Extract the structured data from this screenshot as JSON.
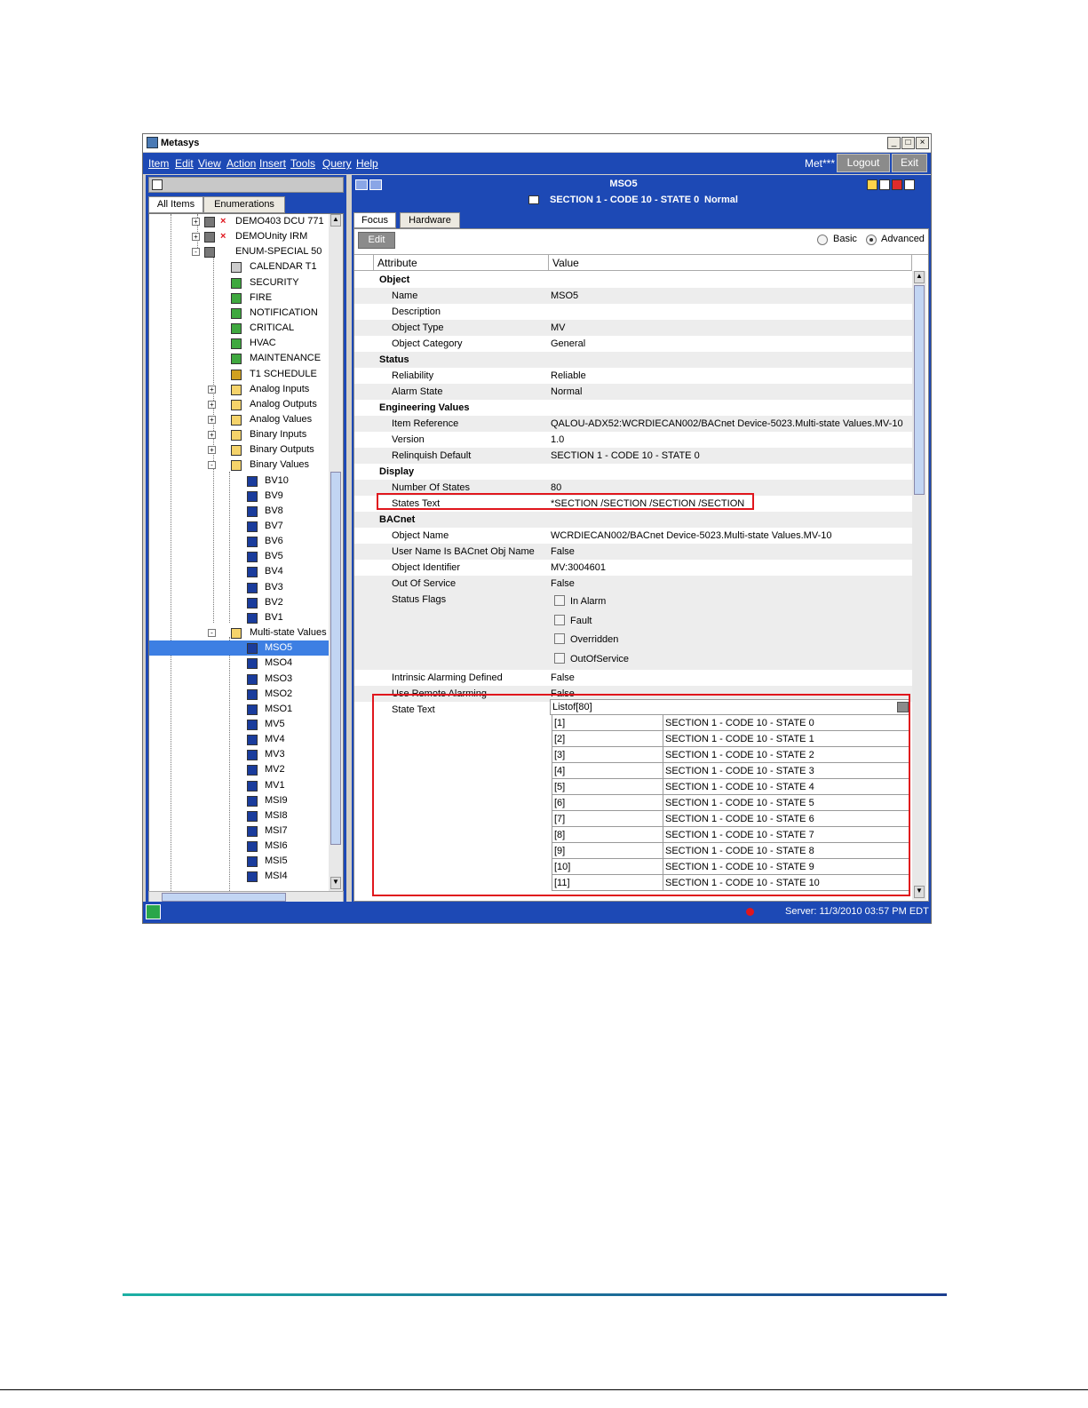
{
  "window": {
    "title": "Metasys"
  },
  "menu": [
    "Item",
    "Edit",
    "View",
    "Action",
    "Insert",
    "Tools",
    "Query",
    "Help"
  ],
  "header": {
    "user": "Met***",
    "logout": "Logout",
    "exit": "Exit"
  },
  "nav": {
    "tabs": [
      "All Items",
      "Enumerations"
    ],
    "tree": [
      {
        "label": "DEMO403 DCU 771",
        "indent": 3,
        "icon": "device-icon",
        "error": true,
        "expander": "+"
      },
      {
        "label": "DEMOUnity IRM",
        "indent": 3,
        "icon": "device-icon",
        "error": true,
        "expander": "+"
      },
      {
        "label": "ENUM-SPECIAL   50",
        "indent": 3,
        "icon": "device-icon",
        "error": false,
        "expander": "-"
      },
      {
        "label": "CALENDAR T1",
        "indent": 4,
        "icon": "calendar-icon"
      },
      {
        "label": "SECURITY",
        "indent": 4,
        "icon": "notification-icon"
      },
      {
        "label": "FIRE",
        "indent": 4,
        "icon": "notification-icon"
      },
      {
        "label": "NOTIFICATION",
        "indent": 4,
        "icon": "notification-icon"
      },
      {
        "label": "CRITICAL",
        "indent": 4,
        "icon": "notification-icon"
      },
      {
        "label": "HVAC",
        "indent": 4,
        "icon": "notification-icon"
      },
      {
        "label": "MAINTENANCE",
        "indent": 4,
        "icon": "notification-icon"
      },
      {
        "label": "T1 SCHEDULE",
        "indent": 4,
        "icon": "schedule-icon"
      },
      {
        "label": "Analog Inputs",
        "indent": 4,
        "icon": "folder-icon",
        "expander": "+"
      },
      {
        "label": "Analog Outputs",
        "indent": 4,
        "icon": "folder-icon",
        "expander": "+"
      },
      {
        "label": "Analog Values",
        "indent": 4,
        "icon": "folder-icon",
        "expander": "+"
      },
      {
        "label": "Binary Inputs",
        "indent": 4,
        "icon": "folder-icon",
        "expander": "+"
      },
      {
        "label": "Binary Outputs",
        "indent": 4,
        "icon": "folder-icon",
        "expander": "+"
      },
      {
        "label": "Binary Values",
        "indent": 4,
        "icon": "folder-icon",
        "expander": "-"
      },
      {
        "label": "BV10",
        "indent": 5,
        "icon": "binary-value-icon"
      },
      {
        "label": "BV9",
        "indent": 5,
        "icon": "binary-value-icon"
      },
      {
        "label": "BV8",
        "indent": 5,
        "icon": "binary-value-icon"
      },
      {
        "label": "BV7",
        "indent": 5,
        "icon": "binary-value-icon"
      },
      {
        "label": "BV6",
        "indent": 5,
        "icon": "binary-value-icon"
      },
      {
        "label": "BV5",
        "indent": 5,
        "icon": "binary-value-icon"
      },
      {
        "label": "BV4",
        "indent": 5,
        "icon": "binary-value-icon"
      },
      {
        "label": "BV3",
        "indent": 5,
        "icon": "binary-value-icon"
      },
      {
        "label": "BV2",
        "indent": 5,
        "icon": "binary-value-icon"
      },
      {
        "label": "BV1",
        "indent": 5,
        "icon": "binary-value-icon"
      },
      {
        "label": "Multi-state Values",
        "indent": 4,
        "icon": "folder-icon",
        "expander": "-"
      },
      {
        "label": "MSO5",
        "indent": 5,
        "icon": "multistate-icon",
        "selected": true
      },
      {
        "label": "MSO4",
        "indent": 5,
        "icon": "multistate-icon"
      },
      {
        "label": "MSO3",
        "indent": 5,
        "icon": "multistate-icon"
      },
      {
        "label": "MSO2",
        "indent": 5,
        "icon": "multistate-icon"
      },
      {
        "label": "MSO1",
        "indent": 5,
        "icon": "multistate-icon"
      },
      {
        "label": "MV5",
        "indent": 5,
        "icon": "multistate-icon"
      },
      {
        "label": "MV4",
        "indent": 5,
        "icon": "multistate-icon"
      },
      {
        "label": "MV3",
        "indent": 5,
        "icon": "multistate-icon"
      },
      {
        "label": "MV2",
        "indent": 5,
        "icon": "multistate-icon"
      },
      {
        "label": "MV1",
        "indent": 5,
        "icon": "multistate-icon"
      },
      {
        "label": "MSI9",
        "indent": 5,
        "icon": "multistate-icon"
      },
      {
        "label": "MSI8",
        "indent": 5,
        "icon": "multistate-icon"
      },
      {
        "label": "MSI7",
        "indent": 5,
        "icon": "multistate-icon"
      },
      {
        "label": "MSI6",
        "indent": 5,
        "icon": "multistate-icon"
      },
      {
        "label": "MSI5",
        "indent": 5,
        "icon": "multistate-icon"
      },
      {
        "label": "MSI4",
        "indent": 5,
        "icon": "multistate-icon"
      }
    ]
  },
  "detail": {
    "object_name": "MSO5",
    "status_line": "SECTION 1 - CODE 10 - STATE 0",
    "status_value": "Normal",
    "tabs": [
      "Focus",
      "Hardware"
    ],
    "edit": "Edit",
    "view_modes": [
      "Basic",
      "Advanced"
    ],
    "selected_mode": "Advanced",
    "columns": [
      "Attribute",
      "Value"
    ],
    "rows": [
      {
        "kind": "group",
        "attr": "Object"
      },
      {
        "attr": "Name",
        "value": "MSO5"
      },
      {
        "attr": "Description",
        "value": ""
      },
      {
        "attr": "Object Type",
        "value": "MV"
      },
      {
        "attr": "Object Category",
        "value": "General"
      },
      {
        "kind": "group",
        "attr": "Status"
      },
      {
        "attr": "Reliability",
        "value": "Reliable"
      },
      {
        "attr": "Alarm State",
        "value": "Normal"
      },
      {
        "kind": "group",
        "attr": "Engineering Values"
      },
      {
        "attr": "Item Reference",
        "value": "QALOU-ADX52:WCRDIECAN002/BACnet Device-5023.Multi-state Values.MV-10"
      },
      {
        "attr": "Version",
        "value": "1.0"
      },
      {
        "attr": "Relinquish Default",
        "value": "SECTION 1 - CODE 10 - STATE 0"
      },
      {
        "kind": "group",
        "attr": "Display"
      },
      {
        "attr": "Number Of States",
        "value": "80"
      },
      {
        "attr": "States Text",
        "value": "*SECTION /SECTION /SECTION /SECTION"
      },
      {
        "kind": "group",
        "attr": "BACnet"
      },
      {
        "attr": "Object Name",
        "value": "WCRDIECAN002/BACnet Device-5023.Multi-state Values.MV-10"
      },
      {
        "attr": "User Name Is BACnet Obj Name",
        "value": "False"
      },
      {
        "attr": "Object Identifier",
        "value": "MV:3004601"
      },
      {
        "attr": "Out Of Service",
        "value": "False"
      }
    ],
    "status_flags_label": "Status Flags",
    "status_flags": [
      "In Alarm",
      "Fault",
      "Overridden",
      "OutOfService"
    ],
    "rows_after": [
      {
        "attr": "Intrinsic Alarming Defined",
        "value": "False"
      },
      {
        "attr": "Use Remote Alarming",
        "value": "False"
      }
    ],
    "state_text": {
      "label": "State Text",
      "header": "Listof[80]",
      "items": [
        {
          "index": "[1]",
          "text": "SECTION 1 - CODE 10 - STATE 0"
        },
        {
          "index": "[2]",
          "text": "SECTION 1 - CODE 10 - STATE 1"
        },
        {
          "index": "[3]",
          "text": "SECTION 1 - CODE 10 - STATE 2"
        },
        {
          "index": "[4]",
          "text": "SECTION 1 - CODE 10 - STATE 3"
        },
        {
          "index": "[5]",
          "text": "SECTION 1 - CODE 10 - STATE 4"
        },
        {
          "index": "[6]",
          "text": "SECTION 1 - CODE 10 - STATE 5"
        },
        {
          "index": "[7]",
          "text": "SECTION 1 - CODE 10 - STATE 6"
        },
        {
          "index": "[8]",
          "text": "SECTION 1 - CODE 10 - STATE 7"
        },
        {
          "index": "[9]",
          "text": "SECTION 1 - CODE 10 - STATE 8"
        },
        {
          "index": "[10]",
          "text": "SECTION 1 - CODE 10 - STATE 9"
        },
        {
          "index": "[11]",
          "text": "SECTION 1 - CODE 10 - STATE 10"
        }
      ]
    }
  },
  "status_bar": {
    "server": "Server: 11/3/2010 03:57 PM EDT"
  },
  "colors": {
    "accent": "#1d49b5",
    "highlight": "#e0161d",
    "selection": "#3d7fe3"
  }
}
